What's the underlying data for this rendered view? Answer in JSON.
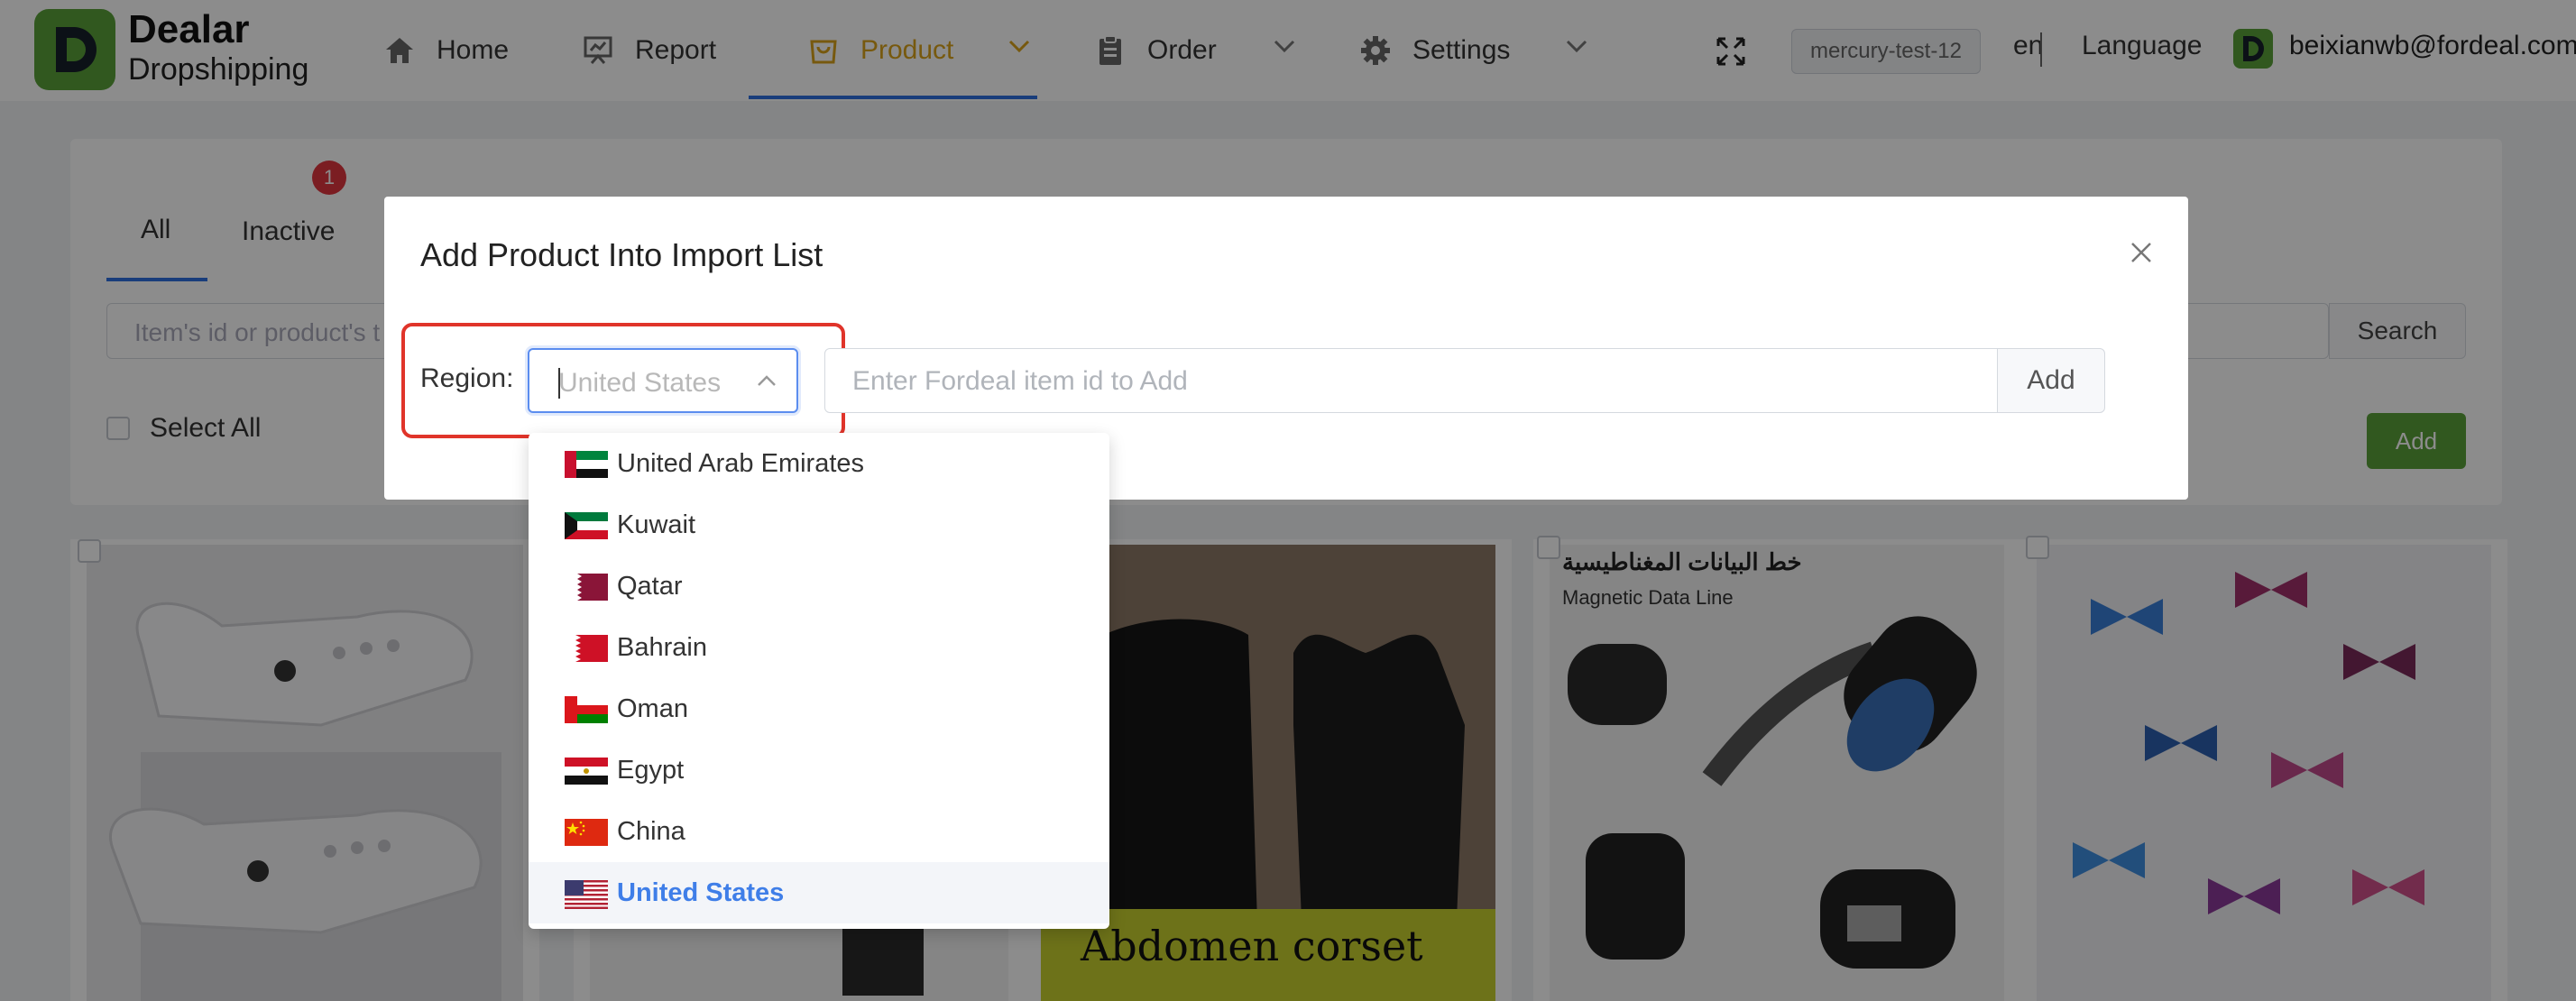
{
  "header": {
    "logo_line1": "Dealar",
    "logo_line2": "Dropshipping",
    "nav": [
      {
        "label": "Home",
        "icon": "home-icon"
      },
      {
        "label": "Report",
        "icon": "report-icon"
      },
      {
        "label": "Product",
        "icon": "shopping-bag-icon",
        "active": true
      },
      {
        "label": "Order",
        "icon": "clipboard-icon"
      },
      {
        "label": "Settings",
        "icon": "gear-icon"
      }
    ],
    "env": "mercury-test-12",
    "lang_code": "en",
    "lang_label": "Language",
    "user_email": "beixianwb@fordeal.com"
  },
  "page": {
    "tabs": [
      {
        "label": "All",
        "active": true
      },
      {
        "label": "Inactive",
        "badge": "1"
      }
    ],
    "search_placeholder": "Item's id or product's t",
    "search_button": "Search",
    "select_all": "Select All",
    "add_button": "Add"
  },
  "products": [
    {
      "name": "white clogs",
      "caption": ""
    },
    {
      "name": "pants",
      "caption": ""
    },
    {
      "name": "abdomen corset",
      "caption": "Abdomen corset"
    },
    {
      "name": "magnetic data line",
      "caption": "خط البيانات المغناطيسية",
      "caption2": "Magnetic Data Line"
    },
    {
      "name": "butterfly stickers",
      "caption": ""
    }
  ],
  "modal": {
    "title": "Add Product Into Import List",
    "region_label": "Region:",
    "region_placeholder": "United States",
    "item_placeholder": "Enter Fordeal item id to Add",
    "add_button": "Add"
  },
  "region_options": [
    {
      "label": "United Arab Emirates",
      "flag": "ae"
    },
    {
      "label": "Kuwait",
      "flag": "kw"
    },
    {
      "label": "Qatar",
      "flag": "qa"
    },
    {
      "label": "Bahrain",
      "flag": "bh"
    },
    {
      "label": "Oman",
      "flag": "om"
    },
    {
      "label": "Egypt",
      "flag": "eg"
    },
    {
      "label": "China",
      "flag": "cn"
    },
    {
      "label": "United States",
      "flag": "us",
      "selected": true
    }
  ],
  "colors": {
    "brand_green": "#5aa03a",
    "accent_blue": "#2e6fe0",
    "active_nav": "#d9a21a",
    "highlight_red": "#e0342a",
    "badge_red": "#e0363f"
  }
}
